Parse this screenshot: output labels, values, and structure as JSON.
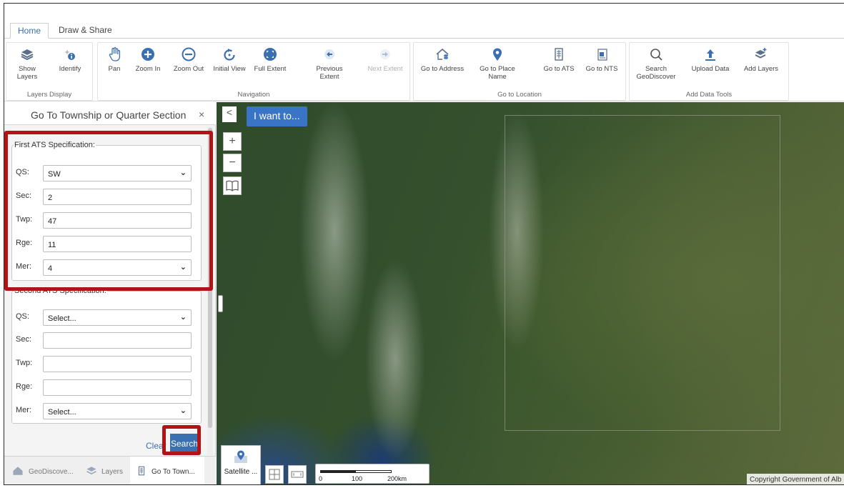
{
  "tabs": [
    {
      "label": "Home",
      "active": true
    },
    {
      "label": "Draw & Share",
      "active": false
    }
  ],
  "ribbon": {
    "groups": [
      {
        "label": "Layers Display",
        "tools": [
          {
            "label": "Show Layers",
            "icon": "layers-icon"
          },
          {
            "label": "Identify",
            "icon": "identify-icon"
          }
        ]
      },
      {
        "label": "Navigation",
        "tools": [
          {
            "label": "Pan",
            "icon": "hand-icon"
          },
          {
            "label": "Zoom In",
            "icon": "zoom-in-icon"
          },
          {
            "label": "Zoom Out",
            "icon": "zoom-out-icon"
          },
          {
            "label": "Initial View",
            "icon": "refresh-icon"
          },
          {
            "label": "Full Extent",
            "icon": "full-extent-icon"
          },
          {
            "label": "Previous Extent",
            "icon": "arrow-left-icon"
          },
          {
            "label": "Next Extent",
            "icon": "arrow-right-icon",
            "disabled": true
          }
        ]
      },
      {
        "label": "Go to Location",
        "tools": [
          {
            "label": "Go to Address",
            "icon": "house-icon"
          },
          {
            "label": "Go to Place Name",
            "icon": "map-pin-icon"
          },
          {
            "label": "Go to ATS",
            "icon": "grid-doc-icon"
          },
          {
            "label": "Go to NTS",
            "icon": "nts-grid-icon"
          }
        ]
      },
      {
        "label": "Add Data Tools",
        "tools": [
          {
            "label": "Search GeoDiscover",
            "icon": "search-icon"
          },
          {
            "label": "Upload Data",
            "icon": "upload-icon"
          },
          {
            "label": "Add Layers",
            "icon": "add-layers-icon"
          }
        ]
      }
    ]
  },
  "panel": {
    "title": "Go To Township or Quarter Section",
    "close": "×",
    "first": {
      "legend": "First ATS Specification:",
      "qs_label": "QS:",
      "qs_value": "SW",
      "sec_label": "Sec:",
      "sec_value": "2",
      "twp_label": "Twp:",
      "twp_value": "47",
      "rge_label": "Rge:",
      "rge_value": "11",
      "mer_label": "Mer:",
      "mer_value": "4"
    },
    "second": {
      "legend": "Second ATS Specification:",
      "qs_label": "QS:",
      "qs_value": "Select...",
      "sec_label": "Sec:",
      "sec_value": "",
      "twp_label": "Twp:",
      "twp_value": "",
      "rge_label": "Rge:",
      "rge_value": "",
      "mer_label": "Mer:",
      "mer_value": "Select..."
    },
    "clear_label": "Clear",
    "search_label": "Search"
  },
  "bottom_tabs": [
    {
      "label": "GeoDiscove...",
      "icon": "house-icon"
    },
    {
      "label": "Layers",
      "icon": "layers-icon"
    },
    {
      "label": "Go To Town...",
      "icon": "grid-doc-icon",
      "active": true
    }
  ],
  "map": {
    "collapse": "<",
    "i_want_to": "I want to...",
    "zoom_in": "+",
    "zoom_out": "−",
    "basemap_label": "Satellite ...",
    "scale_labels": [
      "0",
      "100",
      "200km"
    ],
    "copyright": "Copyright Government of Alb"
  },
  "colors": {
    "accent": "#3a6fb0",
    "highlight": "#b21316",
    "i_want_to_bg": "#3a74c6"
  }
}
